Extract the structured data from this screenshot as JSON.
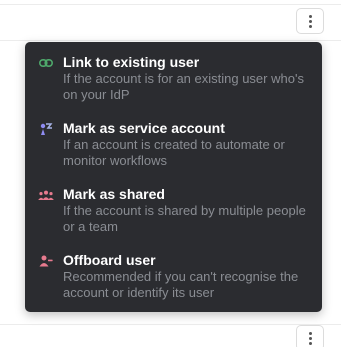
{
  "menu": {
    "items": [
      {
        "icon": "link-icon",
        "icon_color": "#4ea86b",
        "title": "Link to existing user",
        "description": "If the account is for an existing user who's on your IdP"
      },
      {
        "icon": "service-account-icon",
        "icon_color": "#8f8cf2",
        "title": "Mark as service account",
        "description": "If an account is created to automate or monitor workflows"
      },
      {
        "icon": "people-icon",
        "icon_color": "#e77a8e",
        "title": "Mark as shared",
        "description": "If the account is shared by multiple people or a team"
      },
      {
        "icon": "user-remove-icon",
        "icon_color": "#e77a8e",
        "title": "Offboard user",
        "description": "Recommended if you can't recognise the account or identify its user"
      }
    ]
  },
  "colors": {
    "menu_background": "#2b2c30",
    "menu_title": "#ffffff",
    "menu_description": "#8a8d93"
  }
}
